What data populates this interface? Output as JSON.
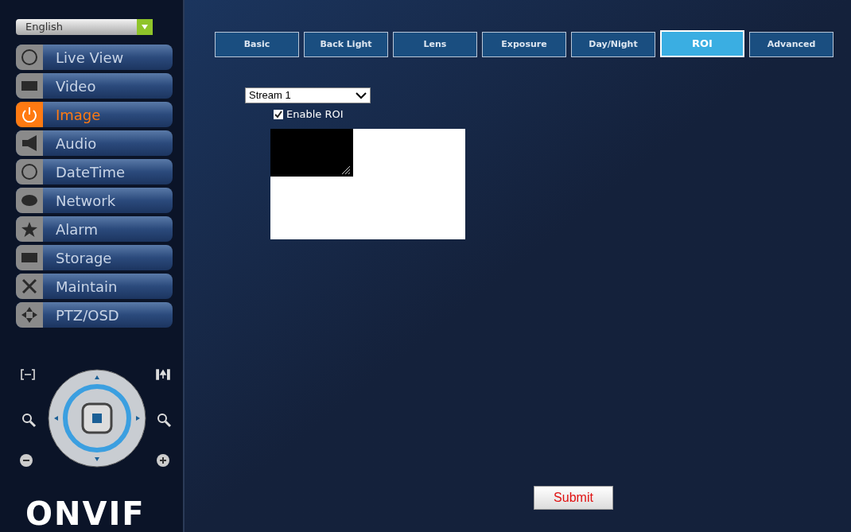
{
  "language": {
    "value": "English"
  },
  "menu": [
    {
      "label": "Live View",
      "selected": false
    },
    {
      "label": "Video",
      "selected": false
    },
    {
      "label": "Image",
      "selected": true
    },
    {
      "label": "Audio",
      "selected": false
    },
    {
      "label": "DateTime",
      "selected": false
    },
    {
      "label": "Network",
      "selected": false
    },
    {
      "label": "Alarm",
      "selected": false
    },
    {
      "label": "Storage",
      "selected": false
    },
    {
      "label": "Maintain",
      "selected": false
    },
    {
      "label": "PTZ/OSD",
      "selected": false
    }
  ],
  "logo": "ONVIF",
  "tabs": [
    {
      "label": "Basic",
      "selected": false
    },
    {
      "label": "Back Light",
      "selected": false
    },
    {
      "label": "Lens",
      "selected": false
    },
    {
      "label": "Exposure",
      "selected": false
    },
    {
      "label": "Day/Night",
      "selected": false
    },
    {
      "label": "ROI",
      "selected": true
    },
    {
      "label": "Advanced",
      "selected": false
    }
  ],
  "stream": {
    "value": "Stream 1"
  },
  "enable_roi": {
    "label": "Enable ROI",
    "checked": true
  },
  "submit": "Submit"
}
